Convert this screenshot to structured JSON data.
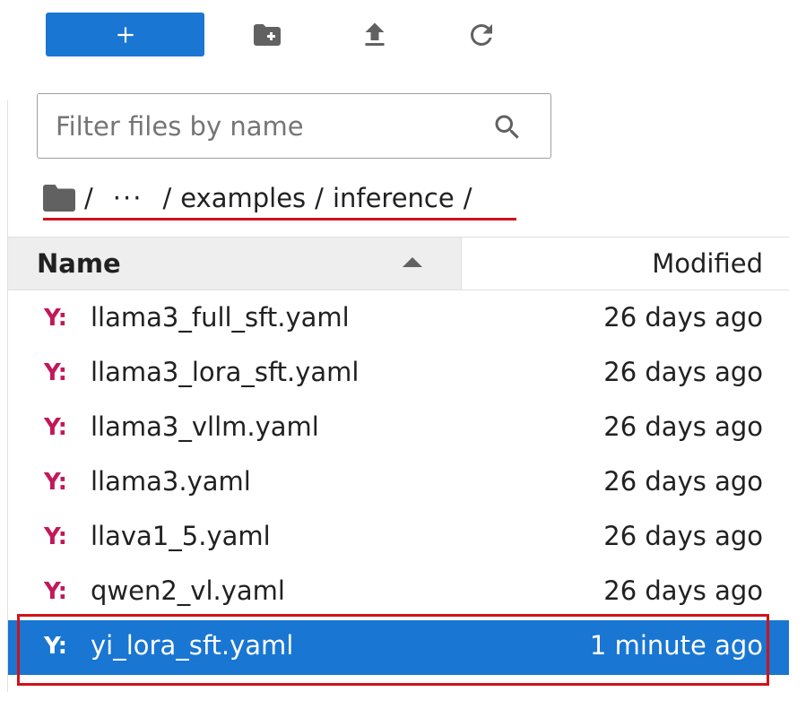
{
  "toolbar": {
    "new_button_icon": "plus-icon",
    "new_folder_icon": "new-folder-icon",
    "upload_icon": "upload-icon",
    "refresh_icon": "refresh-icon"
  },
  "filter": {
    "placeholder": "Filter files by name",
    "value": ""
  },
  "breadcrumb": {
    "sep1": "/",
    "ellipsis": "···",
    "sep2": "/",
    "segment1": "examples",
    "sep3": "/",
    "segment2": "inference",
    "sep4": "/"
  },
  "columns": {
    "name": "Name",
    "modified": "Modified"
  },
  "files": [
    {
      "icon": "Y:",
      "name": "llama3_full_sft.yaml",
      "modified": "26 days ago"
    },
    {
      "icon": "Y:",
      "name": "llama3_lora_sft.yaml",
      "modified": "26 days ago"
    },
    {
      "icon": "Y:",
      "name": "llama3_vllm.yaml",
      "modified": "26 days ago"
    },
    {
      "icon": "Y:",
      "name": "llama3.yaml",
      "modified": "26 days ago"
    },
    {
      "icon": "Y:",
      "name": "llava1_5.yaml",
      "modified": "26 days ago"
    },
    {
      "icon": "Y:",
      "name": "qwen2_vl.yaml",
      "modified": "26 days ago"
    },
    {
      "icon": "Y:",
      "name": "yi_lora_sft.yaml",
      "modified": "1 minute ago",
      "selected": true
    }
  ],
  "colors": {
    "accent": "#1976d2",
    "yaml_icon": "#c2185b",
    "annotation": "#d0121b"
  }
}
